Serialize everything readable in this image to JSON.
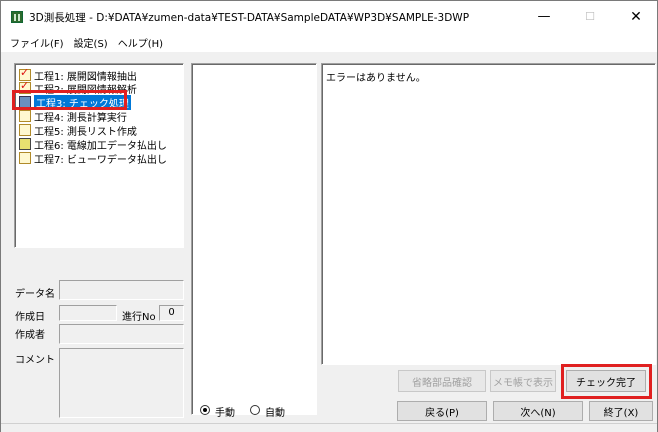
{
  "window": {
    "title": "3D測長処理 - D:¥DATA¥zumen-data¥TEST-DATA¥SampleDATA¥WP3D¥SAMPLE-3DWP",
    "minimize_glyph": "—",
    "maximize_glyph": "☐",
    "close_glyph": "✕"
  },
  "menu": {
    "items": [
      "ファイル(F)",
      "設定(S)",
      "ヘルプ(H)"
    ]
  },
  "steps": [
    {
      "label": "工程1: 展開図情報抽出",
      "icon": "check-doc-icon",
      "state": "done"
    },
    {
      "label": "工程2: 展開図情報解析",
      "icon": "check-doc-icon",
      "state": "done"
    },
    {
      "label": "工程3: チェック処理",
      "icon": "active-doc-icon",
      "state": "selected"
    },
    {
      "label": "工程4: 測長計算実行",
      "icon": "doc-icon",
      "state": "pending"
    },
    {
      "label": "工程5: 測長リスト作成",
      "icon": "doc-icon",
      "state": "pending"
    },
    {
      "label": "工程6: 電線加工データ払出し",
      "icon": "doc-icon",
      "state": "pending"
    },
    {
      "label": "工程7: ビューワデータ払出し",
      "icon": "doc-icon",
      "state": "pending"
    }
  ],
  "info": {
    "data_name_label": "データ名",
    "created_date_label": "作成日",
    "progress_no_label": "進行No",
    "progress_no_value": "0",
    "author_label": "作成者",
    "comment_label": "コメント"
  },
  "messages": {
    "text": "エラーはありません。"
  },
  "buttons": {
    "confirm_omitted": "省略部品確認",
    "show_notepad": "メモ帳で表示",
    "check_complete": "チェック完了",
    "back": "戻る(P)",
    "next": "次へ(N)",
    "finish": "終了(X)"
  },
  "mode": {
    "manual": "手動",
    "auto": "自動",
    "selected": "manual"
  },
  "colors": {
    "highlight": "#e02020",
    "selection": "#0078d7"
  }
}
